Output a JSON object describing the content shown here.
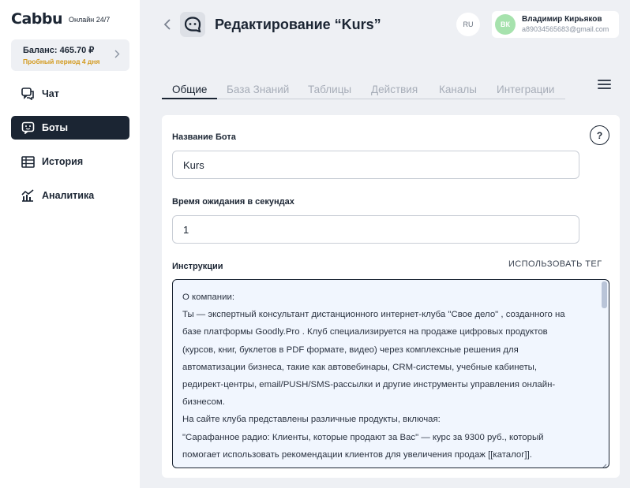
{
  "sidebar": {
    "logo": "Cabbu",
    "logo_sub": "Онлайн 24/7",
    "balance": "Баланс: 465.70 ₽",
    "trial": "Пробный период 4 дня",
    "items": [
      {
        "label": "Чат",
        "icon": "chat-icon"
      },
      {
        "label": "Боты",
        "icon": "bot-icon",
        "active": true
      },
      {
        "label": "История",
        "icon": "table-icon"
      },
      {
        "label": "Аналитика",
        "icon": "analytics-icon"
      }
    ]
  },
  "header": {
    "title": "Редактирование “Kurs”",
    "lang": "RU",
    "user": {
      "initials": "ВК",
      "name": "Владимир Кирьяков",
      "email": "a89034565683@gmail.com"
    }
  },
  "tabs": [
    "Общие",
    "База Знаний",
    "Таблицы",
    "Действия",
    "Каналы",
    "Интеграции"
  ],
  "active_tab": "Общие",
  "form": {
    "bot_name_label": "Название Бота",
    "bot_name_value": "Kurs",
    "timeout_label": "Время ожидания в секундах",
    "timeout_value": "1",
    "instructions_label": "Инструкции",
    "use_tag": "ИСПОЛЬЗОВАТЬ ТЕГ",
    "instructions_lines": [
      "О компании:",
      "Ты — экспертный консультант дистанционного интернет-клуба \"Свое дело\" , созданного на",
      "базе платформы Goodly.Pro . Клуб специализируется на продаже цифровых продуктов",
      "(курсов, книг, буклетов в PDF формате, видео) через комплексные решения для",
      "автоматизации бизнеса, такие как автовебинары, CRM-системы, учебные кабинеты,",
      "редирект-центры, email/PUSH/SMS-рассылки и другие инструменты управления онлайн-",
      "бизнесом.",
      "На сайте клуба представлены различные продукты, включая:",
      "\"Сарафанное радио: Клиенты, которые продают за Вас\" — курс за 9300 руб., который",
      "помогает использовать рекомендации клиентов для увеличения продаж [[каталог]]."
    ]
  },
  "colors": {
    "accent": "#1b2533",
    "background": "#eef0f4",
    "trial": "#d39a1e",
    "avatar": "#a6e2ad",
    "textarea_bg": "#f1f6fe"
  }
}
